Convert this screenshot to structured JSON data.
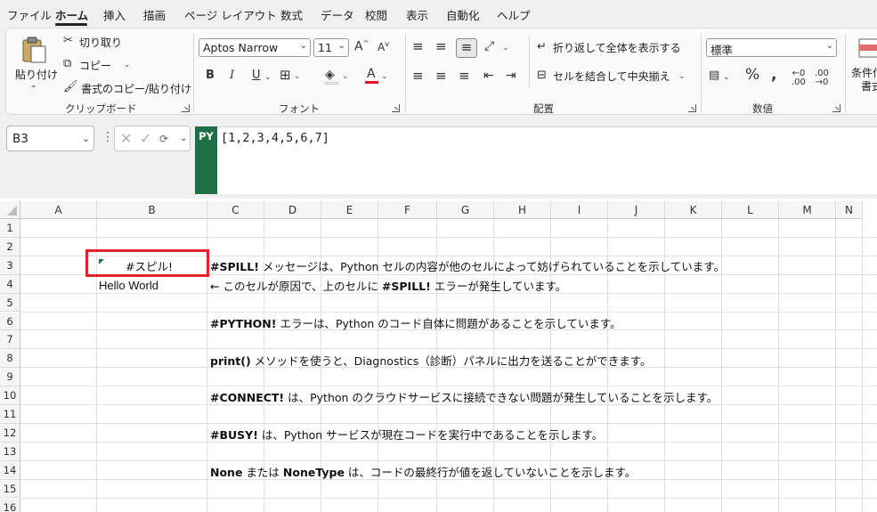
{
  "menu": {
    "tabs": [
      "ファイル",
      "ホーム",
      "挿入",
      "描画",
      "ページ レイアウト",
      "数式",
      "データ",
      "校閲",
      "表示",
      "自動化",
      "ヘルプ"
    ],
    "active_tab": "ホーム"
  },
  "ribbon": {
    "clipboard": {
      "paste_label": "貼り付け",
      "cut_label": "切り取り",
      "copy_label": "コピー",
      "format_painter_label": "書式のコピー/貼り付け",
      "group_label": "クリップボード"
    },
    "font": {
      "font_name": "Aptos Narrow",
      "font_size": "11",
      "bold": "B",
      "italic": "I",
      "underline": "U",
      "group_label": "フォント",
      "font_color": "#e81123"
    },
    "alignment": {
      "wrap_text_label": "折り返して全体を表示する",
      "merge_center_label": "セルを結合して中央揃え",
      "group_label": "配置"
    },
    "number": {
      "format": "標準",
      "group_label": "数値"
    },
    "styles": {
      "conditional_label_1": "条件付",
      "conditional_label_2": "書式"
    }
  },
  "formula_bar": {
    "name_box": "B3",
    "py_badge": "PY",
    "formula": "[1,2,3,4,5,6,7]",
    "py_color": "#1e7145"
  },
  "grid": {
    "columns": [
      "A",
      "B",
      "C",
      "D",
      "E",
      "F",
      "G",
      "H",
      "I",
      "J",
      "K",
      "L",
      "M",
      "N"
    ],
    "rows": [
      "1",
      "2",
      "3",
      "4",
      "5",
      "6",
      "7",
      "8",
      "9",
      "10",
      "11",
      "12",
      "13",
      "14",
      "15",
      "16"
    ],
    "cells": {
      "B3": "#スピル!",
      "B4": "Hello World",
      "C3": {
        "bold": "#SPILL!",
        "rest": " メッセージは、Python セルの内容が他のセルによって妨げられていることを示しています。"
      },
      "C4": {
        "pre": "← このセルが原因で、上のセルに ",
        "bold": "#SPILL!",
        "rest": " エラーが発生しています。"
      },
      "C6": {
        "bold": "#PYTHON!",
        "rest": " エラーは、Python のコード自体に問題があることを示しています。"
      },
      "C8": {
        "bold": "print()",
        "rest": " メソッドを使うと、Diagnostics（診断）パネルに出力を送ることができます。"
      },
      "C10": {
        "bold": "#CONNECT!",
        "rest": " は、Python のクラウドサービスに接続できない問題が発生していることを示します。"
      },
      "C12": {
        "bold": "#BUSY!",
        "rest": " は、Python サービスが現在コードを実行中であることを示します。"
      },
      "C14": {
        "bold": "None",
        "mid": " または ",
        "bold2": "NoneType",
        "rest": " は、コードの最終行が値を返していないことを示します。"
      }
    },
    "highlight_color": "#e0242a"
  }
}
